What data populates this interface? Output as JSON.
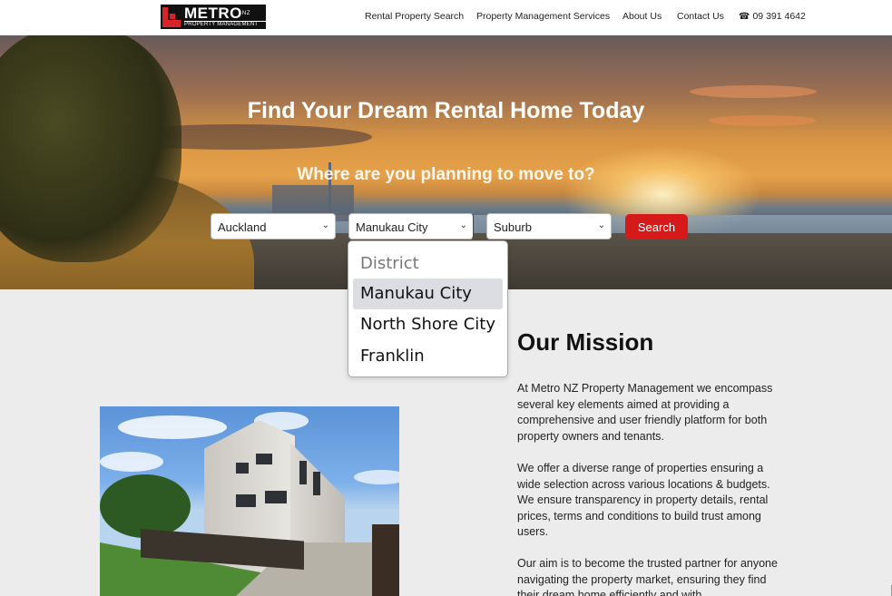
{
  "header": {
    "logo": {
      "brand": "METRO",
      "tag": "NZ",
      "subtitle": "PROPERTY MANAGEMENT"
    },
    "nav": [
      {
        "label": "Rental Property Search"
      },
      {
        "label": "Property Management Services"
      },
      {
        "label": "About Us"
      },
      {
        "label": "Contact Us"
      }
    ],
    "phone": {
      "icon": "phone-icon",
      "number": "09 391 4642"
    }
  },
  "hero": {
    "title": "Find Your Dream Rental Home Today",
    "subtitle": "Where are you planning to move to?",
    "region_select": {
      "value": "Auckland"
    },
    "district_select": {
      "value": "Manukau City"
    },
    "suburb_select": {
      "value": "Suburb"
    },
    "search_label": "Search"
  },
  "district_dropdown": {
    "options": [
      {
        "label": "District",
        "placeholder": true
      },
      {
        "label": "Manukau City",
        "selected": true
      },
      {
        "label": "North Shore City"
      },
      {
        "label": "Franklin"
      }
    ]
  },
  "mission": {
    "title": "Our Mission",
    "paragraphs": [
      "At Metro NZ Property Management we encompass several key elements aimed at providing a comprehensive and user friendly platform for both property owners and tenants.",
      "We offer a diverse range of properties ensuring a wide selection across various locations & budgets. We ensure transparency in property details, rental prices, terms and conditions to build trust among users.",
      "Our aim is to become the trusted partner for anyone navigating the property market, ensuring they find their dream home efficiently and with"
    ]
  },
  "colors": {
    "accent_red": "#d61a1a",
    "header_bg": "#ffffff",
    "section_bg": "#ececec"
  }
}
